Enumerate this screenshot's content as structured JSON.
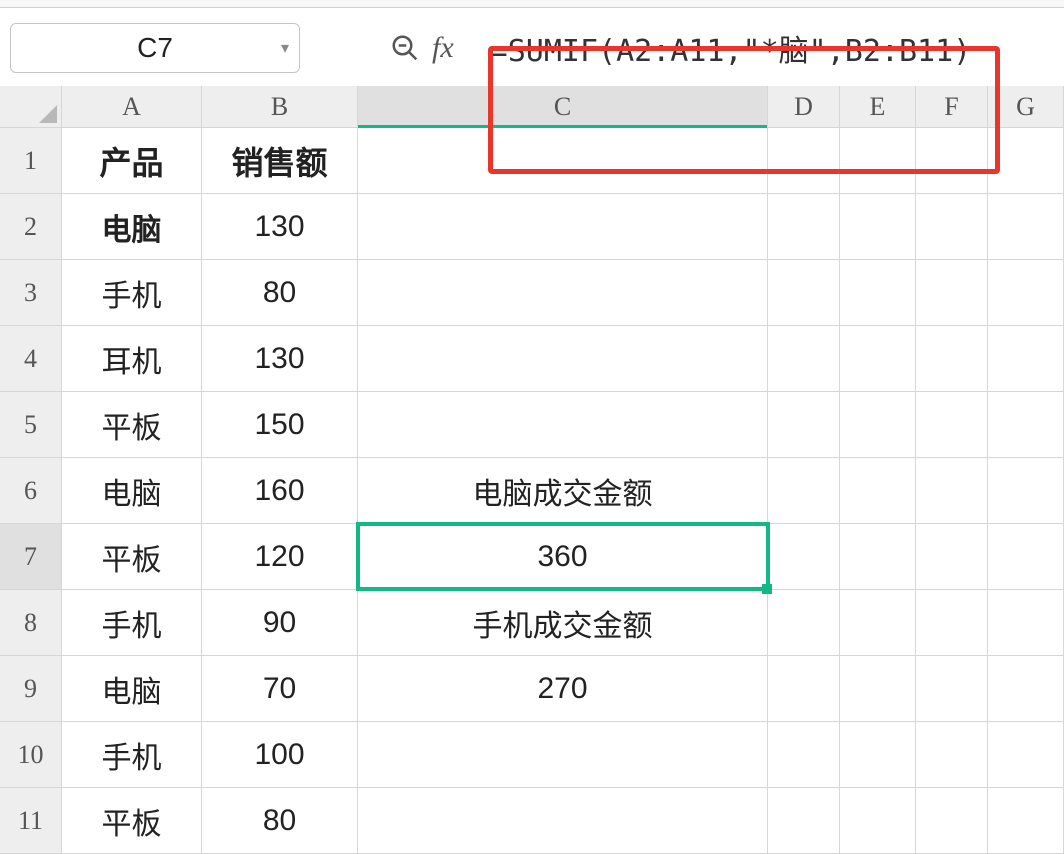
{
  "name_box": "C7",
  "formula": "=SUMIF(A2:A11,\"*脑\",B2:B11)",
  "columns": [
    "A",
    "B",
    "C",
    "D",
    "E",
    "F",
    "G"
  ],
  "selected_column": "C",
  "selected_row": 7,
  "rows": [
    {
      "n": 1,
      "A": "产品",
      "B": "销售额",
      "C": "",
      "bold": true
    },
    {
      "n": 2,
      "A": "电脑",
      "B": "130",
      "C": "",
      "boldA": true
    },
    {
      "n": 3,
      "A": "手机",
      "B": "80",
      "C": ""
    },
    {
      "n": 4,
      "A": "耳机",
      "B": "130",
      "C": ""
    },
    {
      "n": 5,
      "A": "平板",
      "B": "150",
      "C": ""
    },
    {
      "n": 6,
      "A": "电脑",
      "B": "160",
      "C": "电脑成交金额"
    },
    {
      "n": 7,
      "A": "平板",
      "B": "120",
      "C": "360"
    },
    {
      "n": 8,
      "A": "手机",
      "B": "90",
      "C": "手机成交金额"
    },
    {
      "n": 9,
      "A": "电脑",
      "B": "70",
      "C": "270"
    },
    {
      "n": 10,
      "A": "手机",
      "B": "100",
      "C": ""
    },
    {
      "n": 11,
      "A": "平板",
      "B": "80",
      "C": ""
    }
  ]
}
